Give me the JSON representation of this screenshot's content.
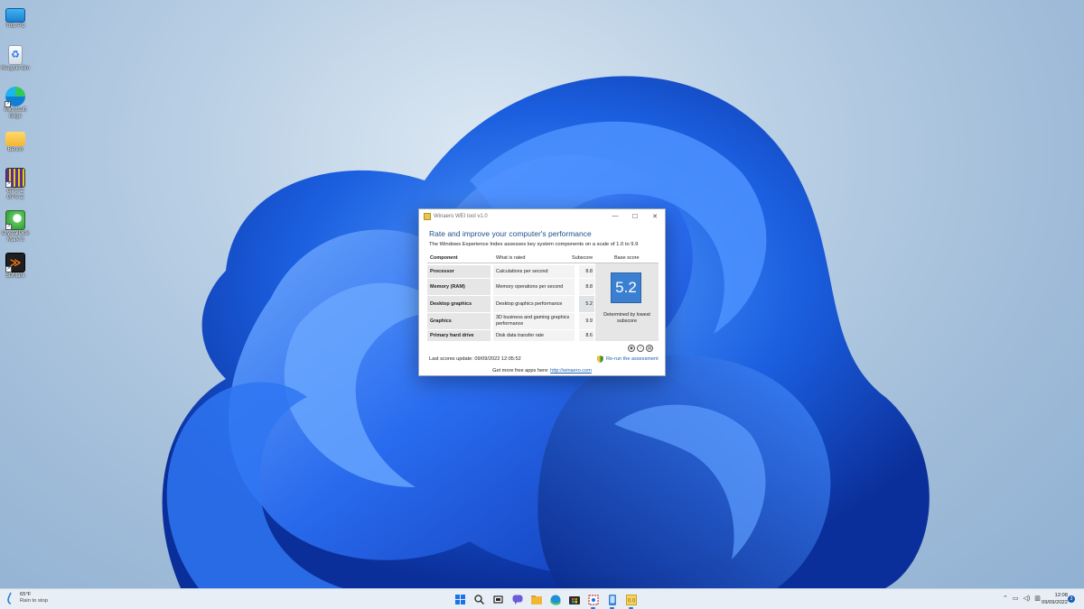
{
  "desktop": {
    "icons": [
      {
        "label": "This PC",
        "icon": "monitor-icon"
      },
      {
        "label": "Recycle Bin",
        "icon": "recycle-bin-icon"
      },
      {
        "label": "Microsoft Edge",
        "icon": "edge-icon"
      },
      {
        "label": "Bench",
        "icon": "folder-icon"
      },
      {
        "label": "GPU-Z GPU-Z",
        "icon": "gpuz-icon"
      },
      {
        "label": "CrystalDiskMark 8",
        "icon": "crystaldiskmark-icon"
      },
      {
        "label": "3DMark",
        "icon": "3dmark-icon"
      }
    ]
  },
  "window": {
    "title": "Winaero WEI tool v1.0",
    "heading": "Rate and improve your computer's performance",
    "subheading": "The Windows Experience Index assesses key system components on a scale of 1.0 to 9.9",
    "columns": {
      "component": "Component",
      "what": "What is rated",
      "subscore": "Subscore",
      "base": "Base score"
    },
    "rows": [
      {
        "component": "Processor",
        "what": "Calculations per second",
        "subscore": "8.8"
      },
      {
        "component": "Memory (RAM)",
        "what": "Memory operations per second",
        "subscore": "8.8"
      },
      {
        "component": "Desktop graphics",
        "what": "Desktop graphics performance",
        "subscore": "5.2"
      },
      {
        "component": "Graphics",
        "what": "3D business and gaming graphics performance",
        "subscore": "9.9"
      },
      {
        "component": "Primary hard drive",
        "what": "Disk data transfer rate",
        "subscore": "8.6"
      }
    ],
    "base_score": "5.2",
    "base_caption": "Determined by lowest subscore",
    "last_update": "Last scores update: 09/09/2022 12:05:52",
    "rerun_label": "Re-run the assessment",
    "footer_text": "Get more free apps here:",
    "footer_link": "http://winaero.com",
    "accent": "#3a7fd0"
  },
  "taskbar": {
    "weather_temp": "65°F",
    "weather_desc": "Rain to stop",
    "apps": [
      "start-icon",
      "search-icon",
      "task-view-icon",
      "chat-icon",
      "file-explorer-icon",
      "edge-icon",
      "store-icon",
      "snipping-tool-icon",
      "phone-link-icon",
      "winaero-icon"
    ],
    "time": "12:08",
    "date": "09/09/2022",
    "notification_count": "3"
  }
}
